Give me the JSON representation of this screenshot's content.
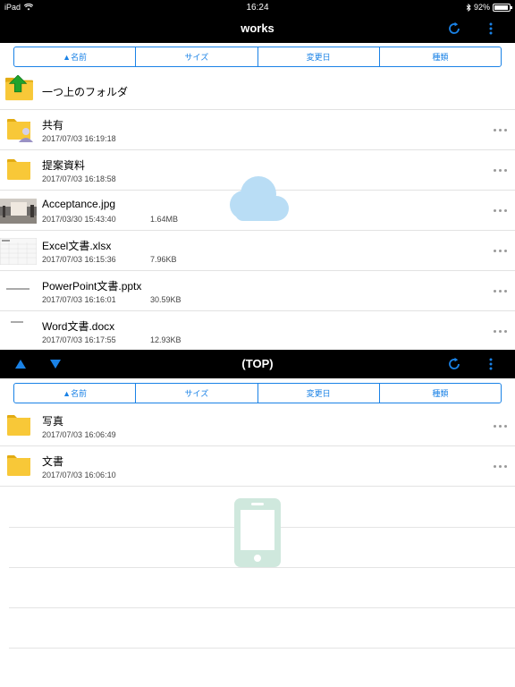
{
  "status_bar": {
    "device": "iPad",
    "time": "16:24",
    "battery": "92%",
    "battery_level": 0.92
  },
  "top_pane": {
    "title": "works",
    "sort_tabs": [
      "▲名前",
      "サイズ",
      "変更日",
      "種類"
    ],
    "parent_folder_label": "一つ上のフォルダ",
    "files": [
      {
        "name": "共有",
        "date": "2017/07/03 16:19:18",
        "size": "",
        "kind": "shared-folder"
      },
      {
        "name": "提案資料",
        "date": "2017/07/03 16:18:58",
        "size": "",
        "kind": "folder"
      },
      {
        "name": "Acceptance.jpg",
        "date": "2017/03/30 15:43:40",
        "size": "1.64MB",
        "kind": "image"
      },
      {
        "name": "Excel文書.xlsx",
        "date": "2017/07/03 16:15:36",
        "size": "7.96KB",
        "kind": "excel"
      },
      {
        "name": "PowerPoint文書.pptx",
        "date": "2017/07/03 16:16:01",
        "size": "30.59KB",
        "kind": "powerpoint"
      },
      {
        "name": "Word文書.docx",
        "date": "2017/07/03 16:17:55",
        "size": "12.93KB",
        "kind": "word"
      }
    ],
    "watermark_icon": "cloud-icon"
  },
  "bottom_pane": {
    "title": "(TOP)",
    "sort_tabs": [
      "▲名前",
      "サイズ",
      "変更日",
      "種類"
    ],
    "files": [
      {
        "name": "写真",
        "date": "2017/07/03 16:06:49",
        "size": "",
        "kind": "folder"
      },
      {
        "name": "文書",
        "date": "2017/07/03 16:06:10",
        "size": "",
        "kind": "folder"
      }
    ],
    "watermark_icon": "phone-icon"
  },
  "colors": {
    "accent": "#1a82e6",
    "folder": "#f8c838",
    "bar": "#000000",
    "cloud": "#b9ddf5",
    "phone": "#cfe8dd"
  }
}
